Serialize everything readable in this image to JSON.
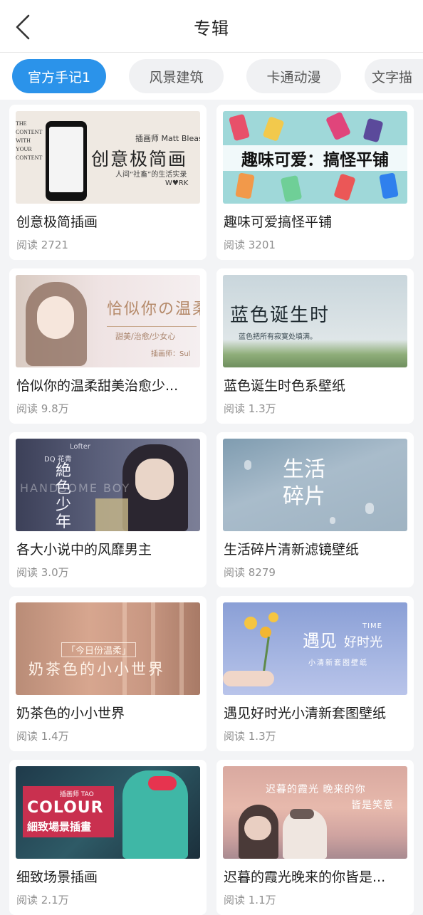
{
  "header": {
    "title": "专辑"
  },
  "tabs": [
    {
      "label": "官方手记1"
    },
    {
      "label": "风景建筑"
    },
    {
      "label": "卡通动漫"
    },
    {
      "label": "文字描"
    }
  ],
  "cards": [
    {
      "title": "创意极简插画",
      "meta": "阅读 2721",
      "overlay": {
        "line1": "插画师 Matt Blease",
        "line2": "创意极简画",
        "line3": "人间“社畜”的生活实录",
        "line4": "W♥RK",
        "side": "THE CONTENT WITH YOUR CONTENT"
      }
    },
    {
      "title": "趣味可爱搞怪平铺",
      "meta": "阅读 3201",
      "overlay": {
        "line1": "趣味可爱：搞怪平铺"
      }
    },
    {
      "title": "恰似你的温柔甜美治愈少...",
      "meta": "阅读 9.8万",
      "overlay": {
        "line1": "恰似你の温柔",
        "line2": "甜美/治愈/少女心",
        "line3": "插画师：Sul"
      }
    },
    {
      "title": "蓝色诞生时色系壁纸",
      "meta": "阅读 1.3万",
      "overlay": {
        "line1": "蓝色诞生时",
        "line2": "蓝色把所有寂寞处填满。"
      }
    },
    {
      "title": "各大小说中的风靡男主",
      "meta": "阅读 3.0万",
      "overlay": {
        "line1": "絶色少年",
        "line2": "DQ 花青",
        "line3": "Lofter",
        "line4": "HANDSOME BOY"
      }
    },
    {
      "title": "生活碎片清新滤镜壁纸",
      "meta": "阅读 8279",
      "overlay": {
        "line1": "生活",
        "line2": "碎片"
      }
    },
    {
      "title": "奶茶色的小小世界",
      "meta": "阅读 1.4万",
      "overlay": {
        "line1": "「今日份温柔」",
        "line2": "奶茶色的小小世界"
      }
    },
    {
      "title": "遇见好时光小清新套图壁纸",
      "meta": "阅读 1.3万",
      "overlay": {
        "line1": "遇见",
        "line2": "TIME",
        "line3": "好时光",
        "line4": "小清新套图壁纸"
      }
    },
    {
      "title": "细致场景插画",
      "meta": "阅读 2.1万",
      "overlay": {
        "line1": "COLOUR",
        "line2": "細致場景插畫",
        "line3": "插画师 TAO"
      }
    },
    {
      "title": "迟暮的霞光晚来的你皆是...",
      "meta": "阅读 1.1万",
      "overlay": {
        "line1": "迟暮的霞光 晚来的你",
        "line2": "皆是笑意"
      }
    }
  ],
  "colors": {
    "accent": "#2b93ea",
    "page_bg": "#f3f4f6",
    "card_bg": "#ffffff",
    "meta_text": "#8f8f8f"
  },
  "icons": {
    "back": "chevron-left-icon"
  }
}
